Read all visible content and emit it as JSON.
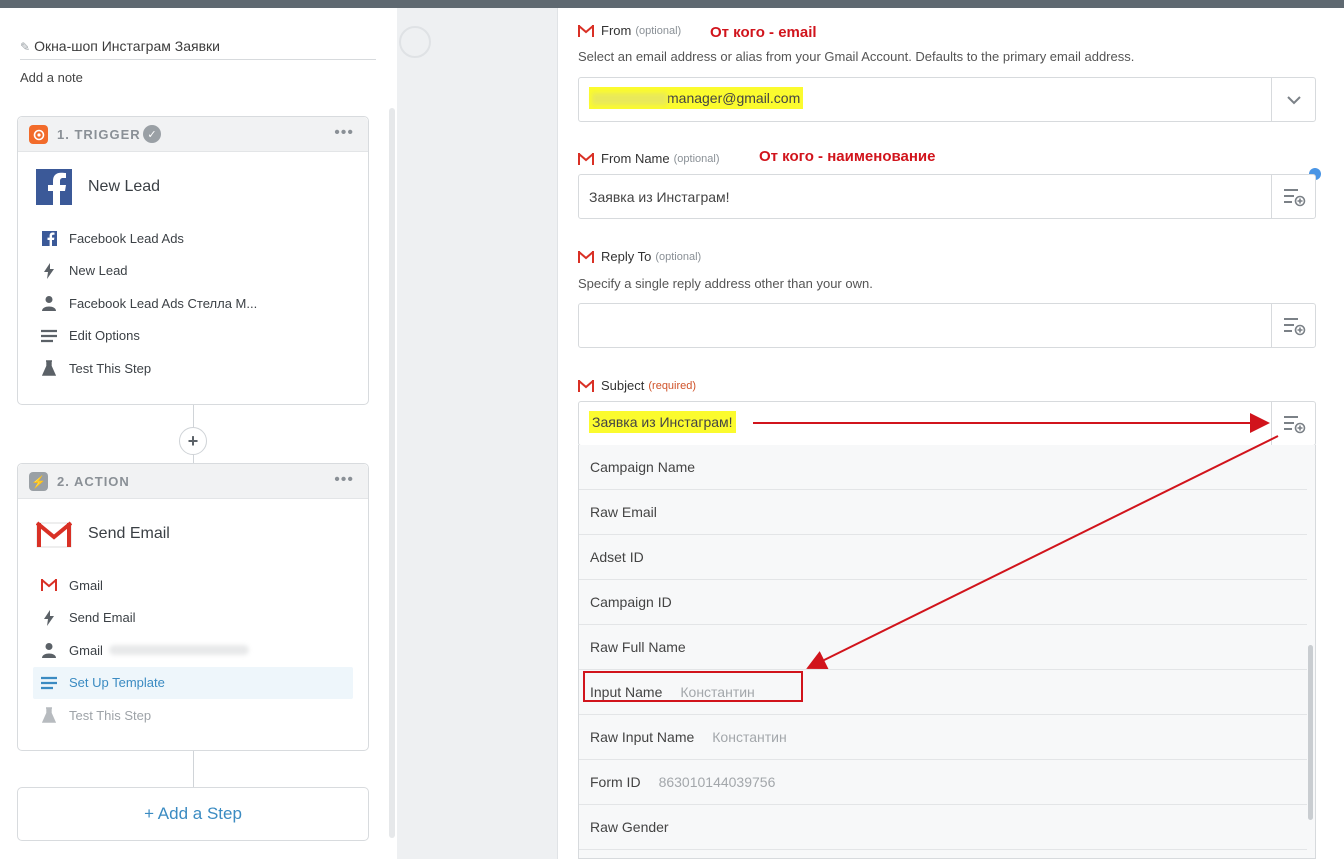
{
  "colors": {
    "topbar": "#5f6971",
    "accent_blue": "#3b8bc2",
    "annotation_red": "#d1141c",
    "highlight_yellow": "#fbfb2e",
    "trigger_orange": "#f26b2a"
  },
  "zap": {
    "title": "Окна-шоп Инстаграм Заявки",
    "add_note": "Add a note"
  },
  "trigger": {
    "step_label": "1. TRIGGER",
    "app_name": "New Lead",
    "items": [
      {
        "icon": "facebook-icon",
        "label": "Facebook Lead Ads"
      },
      {
        "icon": "bolt-icon",
        "label": "New Lead"
      },
      {
        "icon": "user-icon",
        "label": "Facebook Lead Ads Стелла М..."
      },
      {
        "icon": "list-icon",
        "label": "Edit Options"
      },
      {
        "icon": "flask-icon",
        "label": "Test This Step"
      }
    ]
  },
  "action": {
    "step_label": "2. ACTION",
    "app_name": "Send Email",
    "items": [
      {
        "icon": "gmail-icon",
        "label": "Gmail"
      },
      {
        "icon": "bolt-icon",
        "label": "Send Email"
      },
      {
        "icon": "user-icon",
        "label": "Gmail"
      },
      {
        "icon": "list-icon",
        "label": "Set Up Template"
      },
      {
        "icon": "flask-icon",
        "label": "Test This Step"
      }
    ]
  },
  "add_step": "+ Add a Step",
  "form": {
    "from": {
      "label": "From",
      "optional": "(optional)",
      "annotation": "От кого - email",
      "help": "Select an email address or alias from your Gmail Account. Defaults to the primary email address.",
      "value": "manager@gmail.com"
    },
    "from_name": {
      "label": "From Name",
      "optional": "(optional)",
      "annotation": "От кого - наименование",
      "value": "Заявка из Инстаграм!"
    },
    "reply_to": {
      "label": "Reply To",
      "optional": "(optional)",
      "help": "Specify a single reply address other than your own.",
      "value": ""
    },
    "subject": {
      "label": "Subject",
      "required": "(required)",
      "value": "Заявка из Инстаграм!"
    },
    "dropdown": [
      {
        "name": "Campaign Name",
        "sample": ""
      },
      {
        "name": "Raw Email",
        "sample": ""
      },
      {
        "name": "Adset ID",
        "sample": ""
      },
      {
        "name": "Campaign ID",
        "sample": ""
      },
      {
        "name": "Raw Full Name",
        "sample": ""
      },
      {
        "name": "Input Name",
        "sample": "Константин"
      },
      {
        "name": "Raw Input Name",
        "sample": "Константин"
      },
      {
        "name": "Form ID",
        "sample": "863010144039756"
      },
      {
        "name": "Raw Gender",
        "sample": ""
      }
    ]
  }
}
